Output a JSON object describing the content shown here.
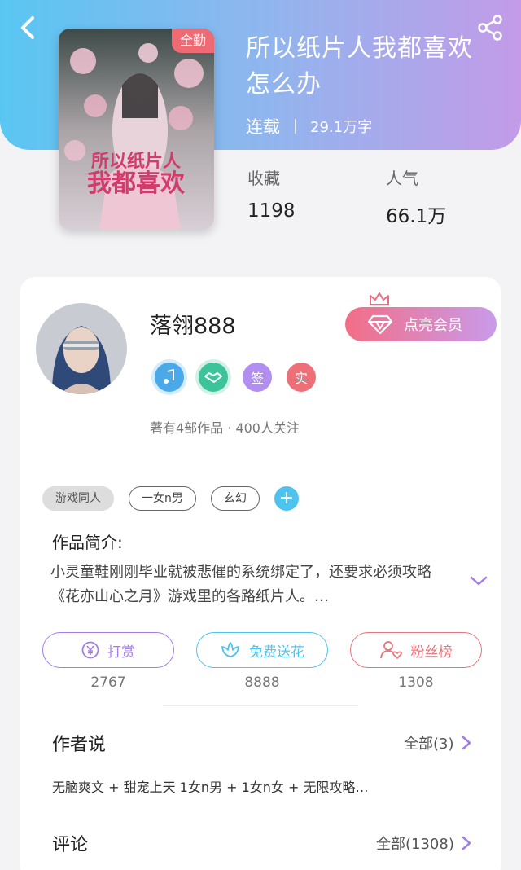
{
  "nav": {
    "back_icon": "chevron-left-icon",
    "share_icon": "share-icon"
  },
  "book": {
    "cover_badge": "全勤",
    "title": "所以纸片人我都喜欢怎么办",
    "status": "连载",
    "word_count": "29.1万字",
    "stats": [
      {
        "label": "收藏",
        "value": "1198"
      },
      {
        "label": "人气",
        "value": "66.1万"
      }
    ]
  },
  "author": {
    "name": "落翎888",
    "vip_button": "点亮会员",
    "badges": [
      {
        "icon": "music-medal-icon",
        "color": "#4aa9e8"
      },
      {
        "icon": "handshake-medal-icon",
        "color": "#3cc39a"
      },
      {
        "text": "签",
        "color": "#b28ef0"
      },
      {
        "text": "实",
        "color": "#ef6f78"
      }
    ],
    "stats_text": "著有4部作品 · 400人关注"
  },
  "tags": [
    "游戏同人",
    "一女n男",
    "玄幻"
  ],
  "intro": {
    "title": "作品简介:",
    "text": "小灵童鞋刚刚毕业就被悲催的系统绑定了，还要求必须攻略《花亦山心之月》游戏里的各路纸片人。…"
  },
  "actions": [
    {
      "label": "打赏",
      "icon": "yen-coin-icon",
      "count": "2767",
      "color": "#a57de8"
    },
    {
      "label": "免费送花",
      "icon": "flower-icon",
      "count": "8888",
      "color": "#4fc3ef"
    },
    {
      "label": "粉丝榜",
      "icon": "user-heart-icon",
      "count": "1308",
      "color": "#e8747c"
    }
  ],
  "author_says": {
    "title": "作者说",
    "more": "全部(3)",
    "text": "无脑爽文 + 甜宠上天 1女n男 + 1女n女 + 无限攻略…"
  },
  "comments": {
    "title": "评论",
    "more": "全部(1308)"
  }
}
